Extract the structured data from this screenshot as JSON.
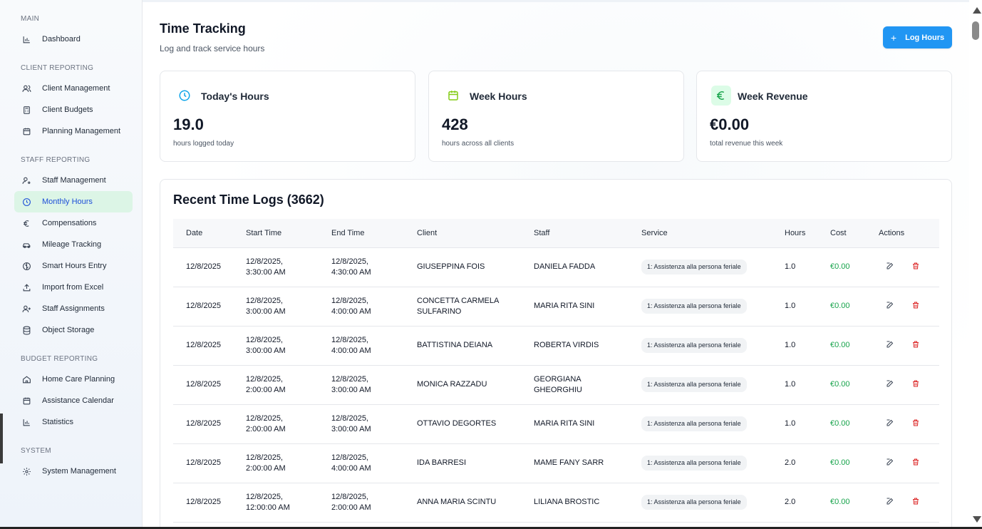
{
  "sidebar": {
    "sections": [
      {
        "title": "MAIN",
        "items": [
          {
            "label": "Dashboard",
            "icon": "bar-chart-icon"
          }
        ]
      },
      {
        "title": "CLIENT REPORTING",
        "items": [
          {
            "label": "Client Management",
            "icon": "users-icon"
          },
          {
            "label": "Client Budgets",
            "icon": "calculator-icon"
          },
          {
            "label": "Planning Management",
            "icon": "calendar-icon"
          }
        ]
      },
      {
        "title": "STAFF REPORTING",
        "items": [
          {
            "label": "Staff Management",
            "icon": "user-cog-icon"
          },
          {
            "label": "Monthly Hours",
            "icon": "clock-icon",
            "active": true
          },
          {
            "label": "Compensations",
            "icon": "euro-icon"
          },
          {
            "label": "Mileage Tracking",
            "icon": "car-icon"
          },
          {
            "label": "Smart Hours Entry",
            "icon": "brain-icon"
          },
          {
            "label": "Import from Excel",
            "icon": "upload-icon"
          },
          {
            "label": "Staff Assignments",
            "icon": "user-plus-icon"
          },
          {
            "label": "Object Storage",
            "icon": "database-icon"
          }
        ]
      },
      {
        "title": "BUDGET REPORTING",
        "items": [
          {
            "label": "Home Care Planning",
            "icon": "home-icon"
          },
          {
            "label": "Assistance Calendar",
            "icon": "calendar-icon"
          },
          {
            "label": "Statistics",
            "icon": "bar-chart-icon"
          }
        ]
      },
      {
        "title": "SYSTEM",
        "items": [
          {
            "label": "System Management",
            "icon": "gear-icon"
          }
        ]
      }
    ]
  },
  "header": {
    "title": "Time Tracking",
    "subtitle": "Log and track service hours",
    "log_button": "Log Hours"
  },
  "stats": [
    {
      "title": "Today's Hours",
      "value": "19.0",
      "desc": "hours logged today",
      "icon": "clock-icon",
      "color": "#0ea5e9"
    },
    {
      "title": "Week Hours",
      "value": "428",
      "desc": "hours across all clients",
      "icon": "calendar-icon",
      "color": "#84cc16"
    },
    {
      "title": "Week Revenue",
      "value": "€0.00",
      "desc": "total revenue this week",
      "icon": "euro-icon",
      "color": "#16a34a"
    }
  ],
  "logs": {
    "title": "Recent Time Logs (3662)",
    "columns": [
      "Date",
      "Start Time",
      "End Time",
      "Client",
      "Staff",
      "Service",
      "Hours",
      "Cost",
      "Actions"
    ],
    "rows": [
      {
        "date": "12/8/2025",
        "start": "12/8/2025, 3:30:00 AM",
        "end": "12/8/2025, 4:30:00 AM",
        "client": "GIUSEPPINA FOIS",
        "staff": "DANIELA FADDA",
        "service": "1: Assistenza alla persona feriale",
        "hours": "1.0",
        "cost": "€0.00"
      },
      {
        "date": "12/8/2025",
        "start": "12/8/2025, 3:00:00 AM",
        "end": "12/8/2025, 4:00:00 AM",
        "client": "CONCETTA CARMELA SULFARINO",
        "staff": "MARIA RITA SINI",
        "service": "1: Assistenza alla persona feriale",
        "hours": "1.0",
        "cost": "€0.00"
      },
      {
        "date": "12/8/2025",
        "start": "12/8/2025, 3:00:00 AM",
        "end": "12/8/2025, 4:00:00 AM",
        "client": "BATTISTINA DEIANA",
        "staff": "ROBERTA VIRDIS",
        "service": "1: Assistenza alla persona feriale",
        "hours": "1.0",
        "cost": "€0.00"
      },
      {
        "date": "12/8/2025",
        "start": "12/8/2025, 2:00:00 AM",
        "end": "12/8/2025, 3:00:00 AM",
        "client": "MONICA RAZZADU",
        "staff": "GEORGIANA GHEORGHIU",
        "service": "1: Assistenza alla persona feriale",
        "hours": "1.0",
        "cost": "€0.00"
      },
      {
        "date": "12/8/2025",
        "start": "12/8/2025, 2:00:00 AM",
        "end": "12/8/2025, 3:00:00 AM",
        "client": "OTTAVIO DEGORTES",
        "staff": "MARIA RITA SINI",
        "service": "1: Assistenza alla persona feriale",
        "hours": "1.0",
        "cost": "€0.00"
      },
      {
        "date": "12/8/2025",
        "start": "12/8/2025, 2:00:00 AM",
        "end": "12/8/2025, 4:00:00 AM",
        "client": "IDA BARRESI",
        "staff": "MAME FANY SARR",
        "service": "1: Assistenza alla persona feriale",
        "hours": "2.0",
        "cost": "€0.00"
      },
      {
        "date": "12/8/2025",
        "start": "12/8/2025, 12:00:00 AM",
        "end": "12/8/2025, 2:00:00 AM",
        "client": "ANNA MARIA SCINTU",
        "staff": "LILIANA BROSTIC",
        "service": "1: Assistenza alla persona feriale",
        "hours": "2.0",
        "cost": "€0.00"
      }
    ]
  }
}
